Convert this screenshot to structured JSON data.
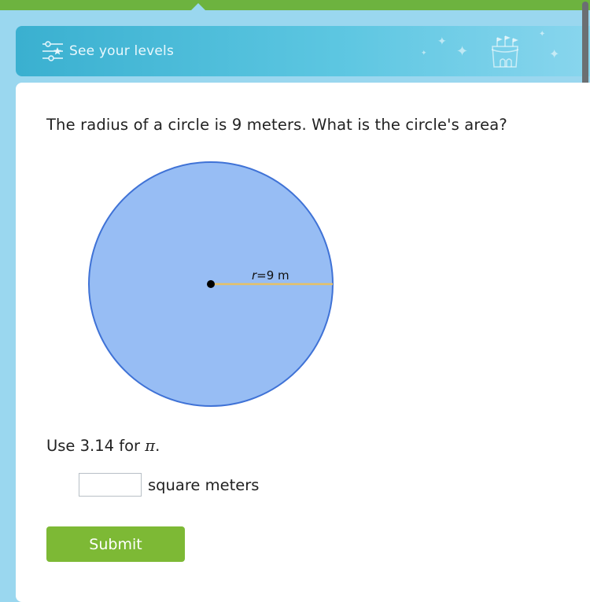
{
  "header": {
    "levels_label": "See your levels",
    "accent_color": "#6db33f"
  },
  "question": {
    "text": "The radius of a circle is 9 meters. What is the circle's area?",
    "pi_note_prefix": "Use 3.14 for ",
    "pi_symbol": "π",
    "pi_note_suffix": "."
  },
  "figure": {
    "radius_value": 9,
    "radius_label_var": "r",
    "radius_label_rest": "=9 m",
    "fill_color": "#97bdf4",
    "stroke_color": "#3f72d6",
    "radius_color": "#e6c066"
  },
  "answer": {
    "value": "",
    "unit_label": "square meters"
  },
  "actions": {
    "submit_label": "Submit",
    "submit_color": "#7db935"
  }
}
